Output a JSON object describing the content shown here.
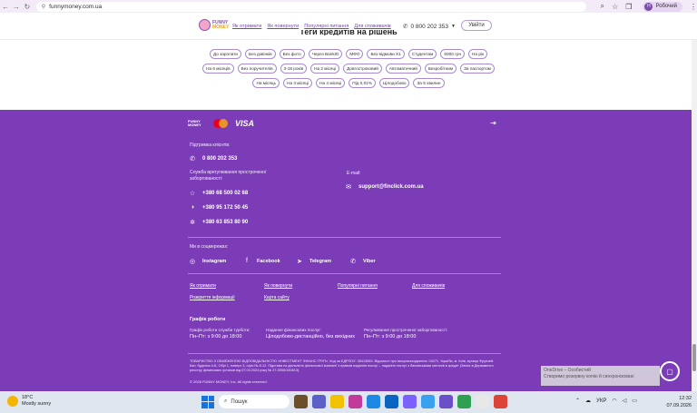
{
  "browser": {
    "url": "funnymoney.com.ua",
    "profile_label": "Робочий",
    "profile_initial": "Н"
  },
  "header": {
    "logo_top": "FUNNY",
    "logo_bottom": "MONEY",
    "nav": [
      "Як отримати",
      "Як повернути",
      "Популярні питання",
      "Для споживачів"
    ],
    "phone": "0 800 202 353",
    "login_label": "Увійти"
  },
  "tags_section": {
    "title": "Теги кредитів на рішень",
    "tags": [
      "До зарплати",
      "Без дзвінків",
      "Без фото",
      "Через BankID",
      "МФО",
      "Без відмови Х1",
      "Студентам",
      "5000 грн",
      "На рік",
      "На 6 місяців",
      "Без поручителів",
      "3-18 років",
      "На 2 місяці",
      "Довгостроковий",
      "Автоматичний",
      "Безробітним",
      "За паспортом",
      "На місяць",
      "На 3 місяці",
      "На 4 місяці",
      "Під 0,01%",
      "Цілодобово",
      "За 5 хвилин"
    ]
  },
  "footer": {
    "card_brand": "FUNNY MONEY",
    "visa": "VISA",
    "support_label": "Підтримка клієнтів:",
    "support_phone": "0 800 202 353",
    "debt_label": "Служба врегулювання простроченої заборгованості:",
    "debt_phones": [
      "+380 68 500 02 68",
      "+380 95 172 50 45",
      "+380 63 853 80 90"
    ],
    "email_label": "E-mail:",
    "email": "support@finclick.com.ua",
    "social_label": "Ми в соцмережах:",
    "socials": [
      "Instagram",
      "Facebook",
      "Telegram",
      "Viber"
    ],
    "links": [
      "Як отримати",
      "Як повернути",
      "Популярні питання",
      "Для споживачів",
      "Розкриття інформації",
      "Карта сайту"
    ],
    "schedule_title": "Графік роботи",
    "schedules": [
      {
        "title": "Графік роботи служби турботи:",
        "value": "Пн–Пт: з 9:00 до 18:00"
      },
      {
        "title": "Надання фінансових послуг:",
        "value": "Цілодобово-дистанційно, без вихідних"
      },
      {
        "title": "Регулювання простроченої заборгованості:",
        "value": "Пн–Пт: з 9:00 до 18:00"
      }
    ],
    "legal": "ТОВАРИСТВО З ОБМЕЖЕНОЮ ВІДПОВІДАЛЬНІСТЮ «ІНВЕСТМЕНТ ФІНАНС ГРУП», Код за ЄДРПОУ: 35413053. Відомості про місцезнаходження: 04071, Україба, м. Київ, вулиця Фрунзей-Кан, будинок 4-Б, Обрі 1, поверх 3, офіс № 8-12. Підстава на діяльність фінансової компанії з правом надання послуг – надання послуг з банківськими металів в кредит (Запис в Державного реєстру фінансових установ від 07.03.2024 року № 27-0005/160613).",
    "copyright": "© 2026 FUNNY MONEY, Inc. All rights reserved."
  },
  "toast": {
    "title": "OneDrive – Особистий",
    "body": "Створимо резервну копію й синхронізовані"
  },
  "taskbar": {
    "temp": "18°C",
    "weather": "Mostly sunny",
    "search": "Пошук",
    "lang": "УКР",
    "time": "12:32",
    "date": "07.09.2026"
  }
}
